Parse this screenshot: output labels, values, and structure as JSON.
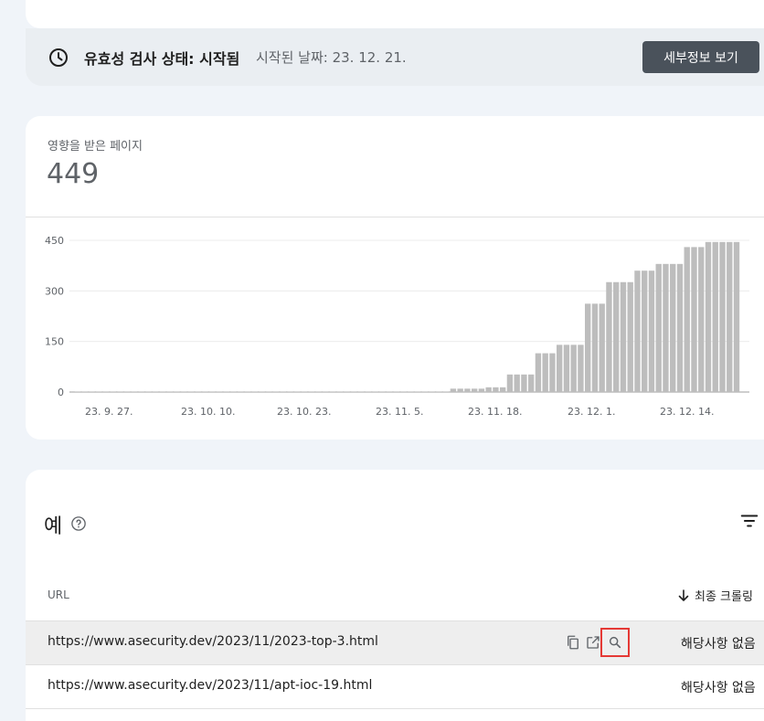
{
  "validation": {
    "status_label": "유효성 검사 상태: ",
    "status_value": "시작됨",
    "started_text": "시작된 날짜: 23. 12. 21.",
    "details_button": "세부정보 보기"
  },
  "metric": {
    "label": "영향을 받은 페이지",
    "value": "449"
  },
  "chart_data": {
    "type": "bar",
    "ylim": [
      0,
      450
    ],
    "y_ticks": [
      "0",
      "150",
      "300",
      "450"
    ],
    "x_tick_labels": [
      "23. 9. 27.",
      "23. 10. 10.",
      "23. 10. 23.",
      "23. 11. 5.",
      "23. 11. 18.",
      "23. 12. 1.",
      "23. 12. 14."
    ],
    "x_start": "23. 9. 27.",
    "values": [
      0,
      0,
      0,
      0,
      0,
      0,
      0,
      0,
      0,
      0,
      0,
      0,
      0,
      0,
      0,
      0,
      0,
      0,
      0,
      0,
      0,
      0,
      0,
      0,
      0,
      0,
      0,
      0,
      0,
      0,
      0,
      0,
      0,
      0,
      0,
      0,
      0,
      0,
      0,
      0,
      0,
      0,
      0,
      0,
      0,
      0,
      0,
      0,
      0,
      0,
      0,
      0,
      0,
      10,
      10,
      10,
      10,
      10,
      14,
      14,
      14,
      52,
      52,
      52,
      52,
      115,
      115,
      115,
      140,
      140,
      140,
      140,
      262,
      262,
      262,
      326,
      326,
      326,
      326,
      360,
      360,
      360,
      380,
      380,
      380,
      380,
      430,
      430,
      430,
      445,
      445,
      445,
      445,
      445
    ],
    "bar_color": "#bdbdbd",
    "grid": true
  },
  "table": {
    "title": "예",
    "col_url": "URL",
    "col_crawl": "최종 크롤링",
    "rows": [
      {
        "url": "https://www.asecurity.dev/2023/11/2023-top-3.html",
        "crawl": "해당사항 없음"
      },
      {
        "url": "https://www.asecurity.dev/2023/11/apt-ioc-19.html",
        "crawl": "해당사항 없음"
      }
    ]
  },
  "colors": {
    "accent_button": "#4a525b",
    "highlight_box": "#e53935"
  }
}
